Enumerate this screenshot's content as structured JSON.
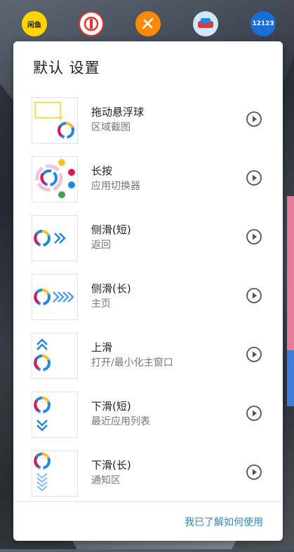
{
  "background_apps": [
    {
      "name": "闲鱼",
      "icon": "xianyu-app-icon",
      "color": "#ffd500"
    },
    {
      "name": "铁路12306",
      "icon": "railway-app-icon",
      "color": "#e8312f"
    },
    {
      "name": "",
      "icon": "delivery-app-icon",
      "color": "#ff8a00"
    },
    {
      "name": "",
      "icon": "car-app-icon",
      "color": "#1e88e5"
    },
    {
      "name": "12123",
      "icon": "traffic-12123-app-icon",
      "color": "#1a6fd6"
    }
  ],
  "dialog": {
    "title": "默认 设置",
    "items": [
      {
        "label": "拖动悬浮球",
        "sub": "区域截图",
        "icon": "drag-ball-icon"
      },
      {
        "label": "长按",
        "sub": "应用切换器",
        "icon": "long-press-icon"
      },
      {
        "label": "侧滑(短)",
        "sub": "返回",
        "icon": "swipe-side-short-icon"
      },
      {
        "label": "侧滑(长)",
        "sub": "主页",
        "icon": "swipe-side-long-icon"
      },
      {
        "label": "上滑",
        "sub": "打开/最小化主窗口",
        "icon": "swipe-up-icon"
      },
      {
        "label": "下滑(短)",
        "sub": "最近应用列表",
        "icon": "swipe-down-short-icon"
      },
      {
        "label": "下滑(长)",
        "sub": "通知区",
        "icon": "swipe-down-long-icon"
      }
    ],
    "footer_button": "我已了解如何使用"
  },
  "colors": {
    "accent": "#2b8ad1",
    "ring_red": "#d81b60",
    "ring_blue": "#1e88e5",
    "ring_yellow": "#fbc02d",
    "ring_green": "#43a047"
  }
}
